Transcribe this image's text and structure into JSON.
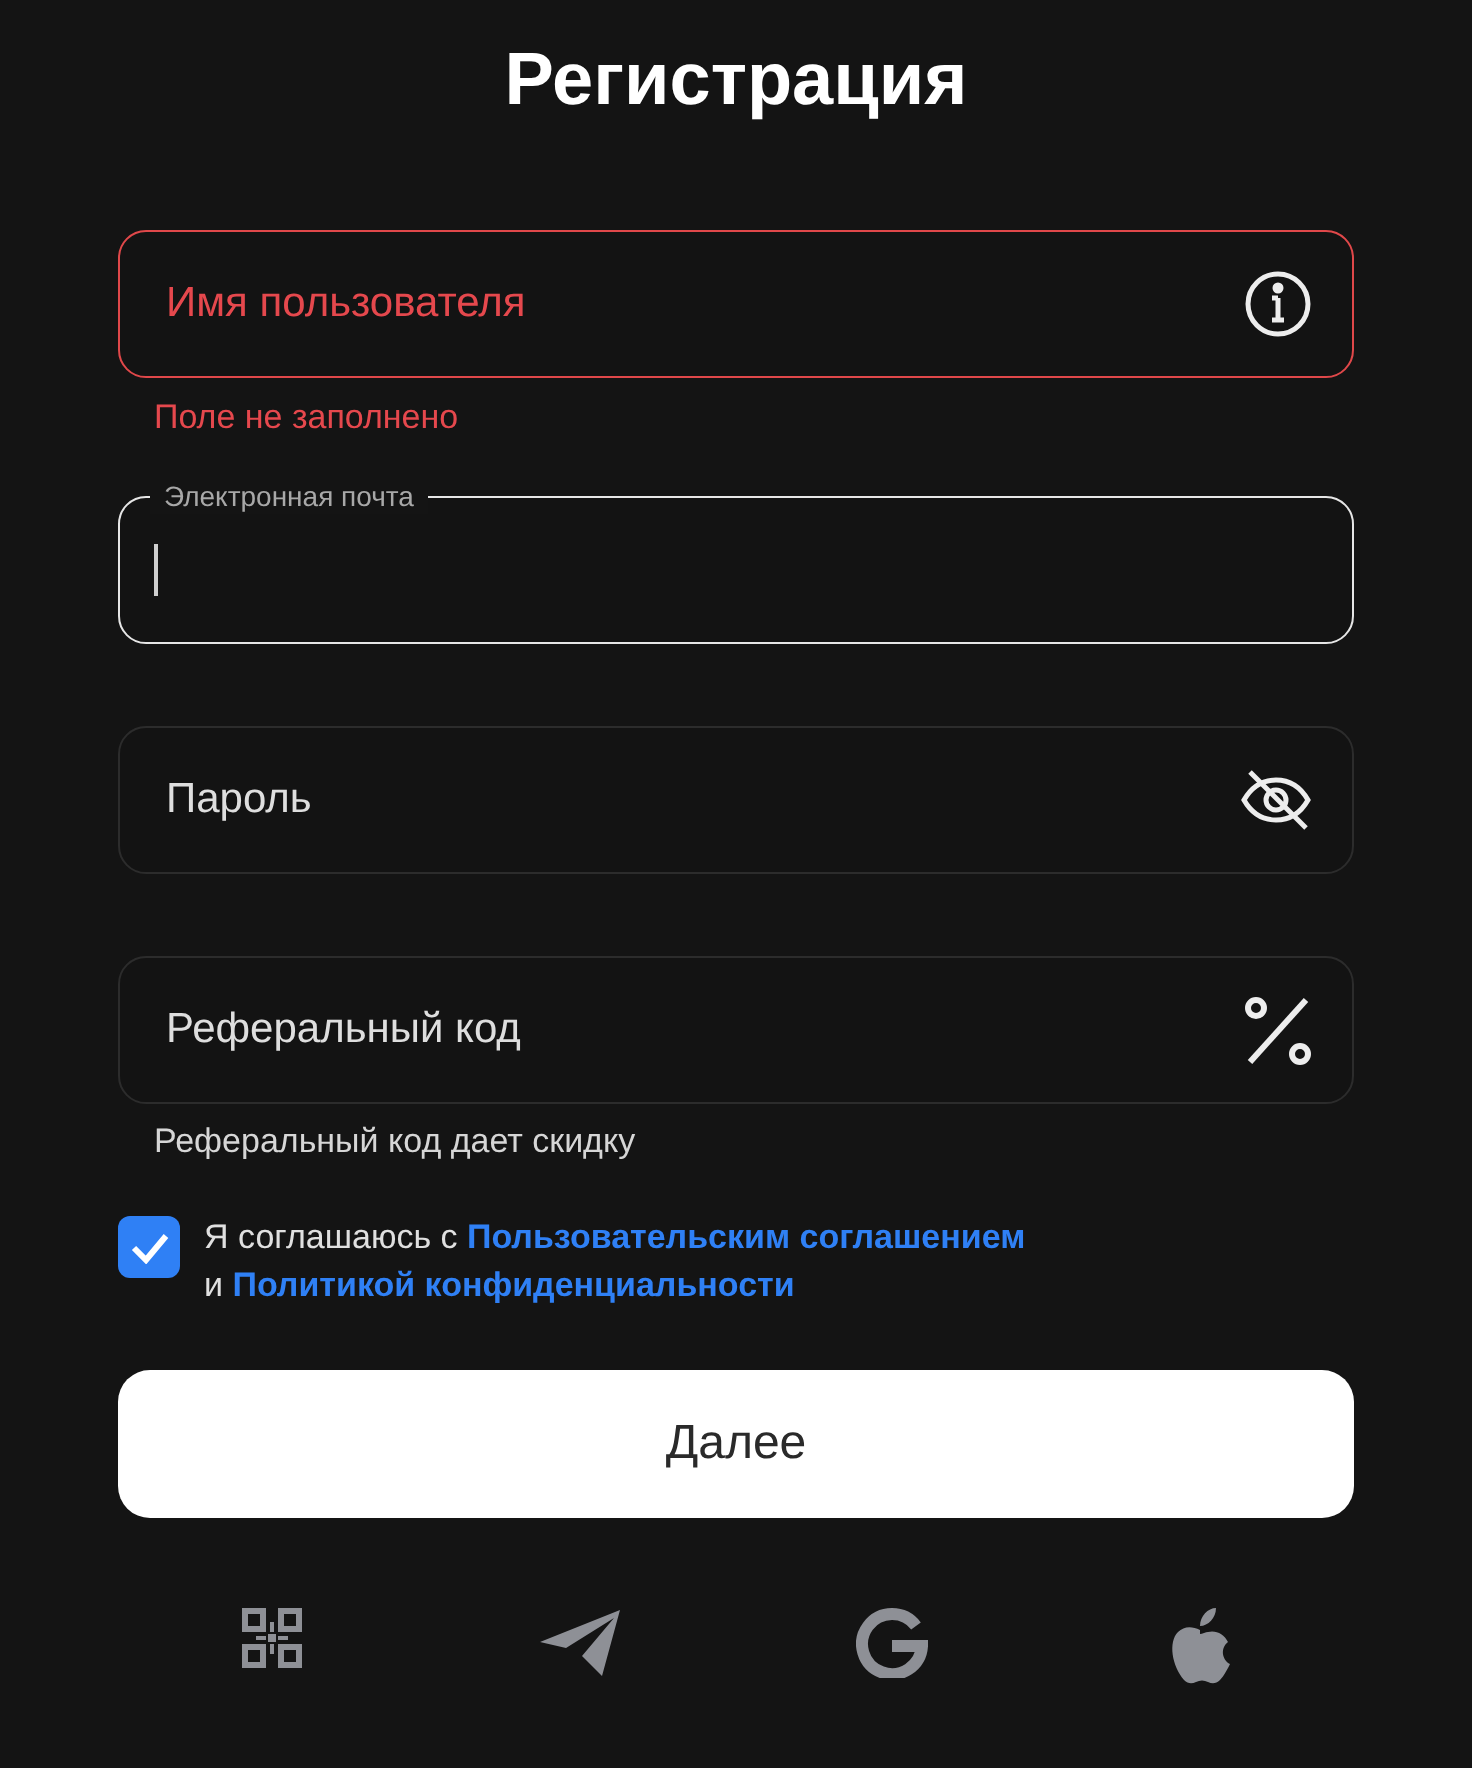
{
  "title": "Регистрация",
  "fields": [
    {
      "kind": "text",
      "placeholder": "Имя пользователя",
      "error": true,
      "focused": false,
      "message": "Поле не заполнено"
    },
    {
      "kind": "email",
      "label": "Электронная почта",
      "error": false,
      "focused": true
    },
    {
      "kind": "password",
      "placeholder": "Пароль",
      "error": false,
      "focused": false
    },
    {
      "kind": "promo",
      "placeholder": "Реферальный код",
      "error": false,
      "focused": false,
      "hint": "Реферальный код дает скидку"
    }
  ],
  "consent": {
    "checked": true,
    "text_1": "Я соглашаюсь с",
    "link_1": "Пользовательским соглашением",
    "text_2": "и",
    "link_2": "Политикой конфиденциальности"
  },
  "submit": "Далее"
}
